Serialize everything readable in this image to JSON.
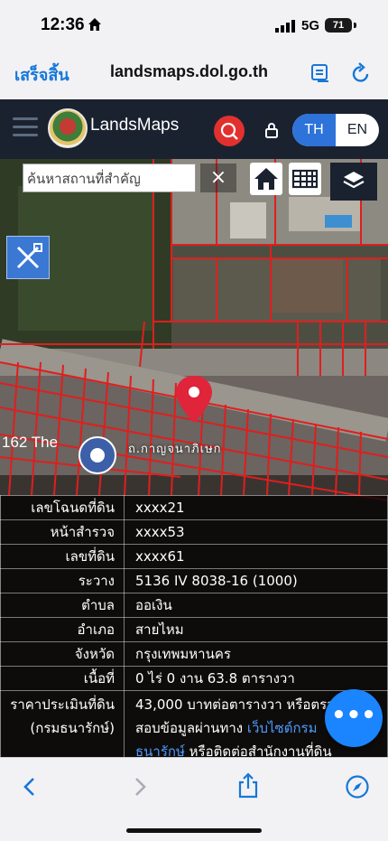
{
  "status": {
    "time": "12:36",
    "network": "5G",
    "battery": "71"
  },
  "browser": {
    "done_label": "เสร็จสิ้น",
    "url": "landsmaps.dol.go.th"
  },
  "app": {
    "brand": "LandsMaps",
    "lang_th": "TH",
    "lang_en": "EN"
  },
  "map": {
    "search_placeholder": "ค้นหาสถานที่สำคัญ",
    "clear": "×",
    "parcel_label": "ถ.กาญจนาภิเษก",
    "poi_label": "162 The"
  },
  "info": {
    "rows": [
      {
        "key": "เลขโฉนดที่ดิน",
        "value": "xxxx21"
      },
      {
        "key": "หน้าสำรวจ",
        "value": "xxxx53"
      },
      {
        "key": "เลขที่ดิน",
        "value": "xxxx61"
      },
      {
        "key": "ระวาง",
        "value": "5136 IV 8038-16 (1000)"
      },
      {
        "key": "ตำบล",
        "value": "ออเงิน"
      },
      {
        "key": "อำเภอ",
        "value": "สายไหม"
      },
      {
        "key": "จังหวัด",
        "value": "กรุงเทพมหานคร"
      },
      {
        "key": "เนื้อที่",
        "value": "0 ไร่ 0 งาน 63.8 ตารางวา"
      }
    ],
    "price": {
      "key_line1": "ราคาประเมินที่ดิน",
      "key_line2": "(กรมธนารักษ์)",
      "line1": "43,000 บาทต่อตารางวา หรือตรวจ",
      "line2_text": "สอบข้อมูลผ่านทาง ",
      "line2_link": "เว็บไซต์กรม",
      "line3_link": "ธนารักษ์",
      "line3_text": " หรือติดต่อสำนักงานที่ดิน"
    }
  },
  "fab_label": "•••"
}
